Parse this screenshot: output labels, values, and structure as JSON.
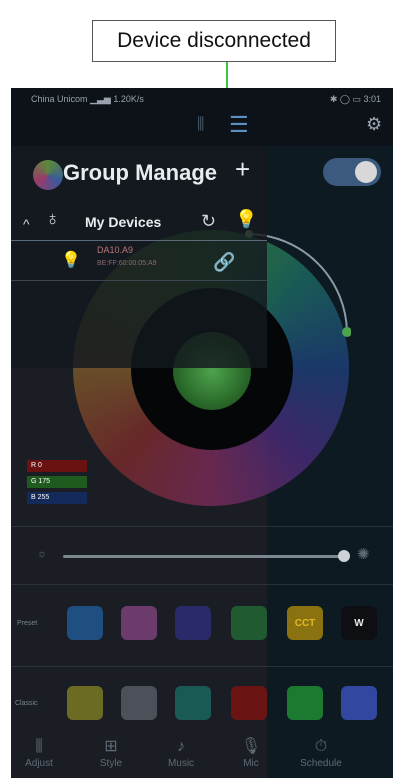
{
  "annotation": {
    "text": "Device disconnected"
  },
  "status_bar": {
    "carrier": "China Unicom",
    "signal": "📶",
    "speed": "1.20K/s",
    "icons": "✱ ◯ ▭",
    "time": "3:01"
  },
  "topbar": {
    "eq_icon": "equalizer-icon",
    "list_icon": "list-icon",
    "settings_icon": "gear-icon"
  },
  "group": {
    "title": "Group Manage",
    "plus": "+"
  },
  "devices": {
    "chevron": "^",
    "label": "My Devices",
    "refresh": "↻",
    "items": [
      {
        "name": "DA10.A9",
        "mac": "BE:FF:60:00:05:A9",
        "status": "disconnected"
      }
    ]
  },
  "rgb": {
    "r": "R  0",
    "g": "G  175",
    "b": "B  255"
  },
  "brightness": {
    "low_icon": "sun-low-icon",
    "high_icon": "sun-high-icon",
    "level": 0.97
  },
  "preset": {
    "label": "Preset",
    "chips": [
      {
        "color": "#1e4f80",
        "label": ""
      },
      {
        "color": "#6b3c6b",
        "label": ""
      },
      {
        "color": "#2a2a6a",
        "label": ""
      },
      {
        "color": "#1f5a30",
        "label": ""
      },
      {
        "color": "#8a7210",
        "label": "CCT"
      },
      {
        "color": "#0d0f12",
        "label": "W"
      }
    ]
  },
  "classic": {
    "label": "Classic",
    "chips": [
      {
        "color": "#6b6b24"
      },
      {
        "color": "#4c5058"
      },
      {
        "color": "#1a5a55"
      },
      {
        "color": "#6a1414"
      },
      {
        "color": "#1c7a30"
      },
      {
        "color": "#3247a0"
      }
    ]
  },
  "tabs": [
    {
      "label": "Adjust",
      "icon": "equalizer-icon",
      "glyph": "⫼"
    },
    {
      "label": "Style",
      "icon": "grid-icon",
      "glyph": "⊞"
    },
    {
      "label": "Music",
      "icon": "music-icon",
      "glyph": "♪"
    },
    {
      "label": "Mic",
      "icon": "microphone-icon",
      "glyph": "🎙"
    },
    {
      "label": "Schedule",
      "icon": "clock-icon",
      "glyph": "⏱"
    }
  ]
}
